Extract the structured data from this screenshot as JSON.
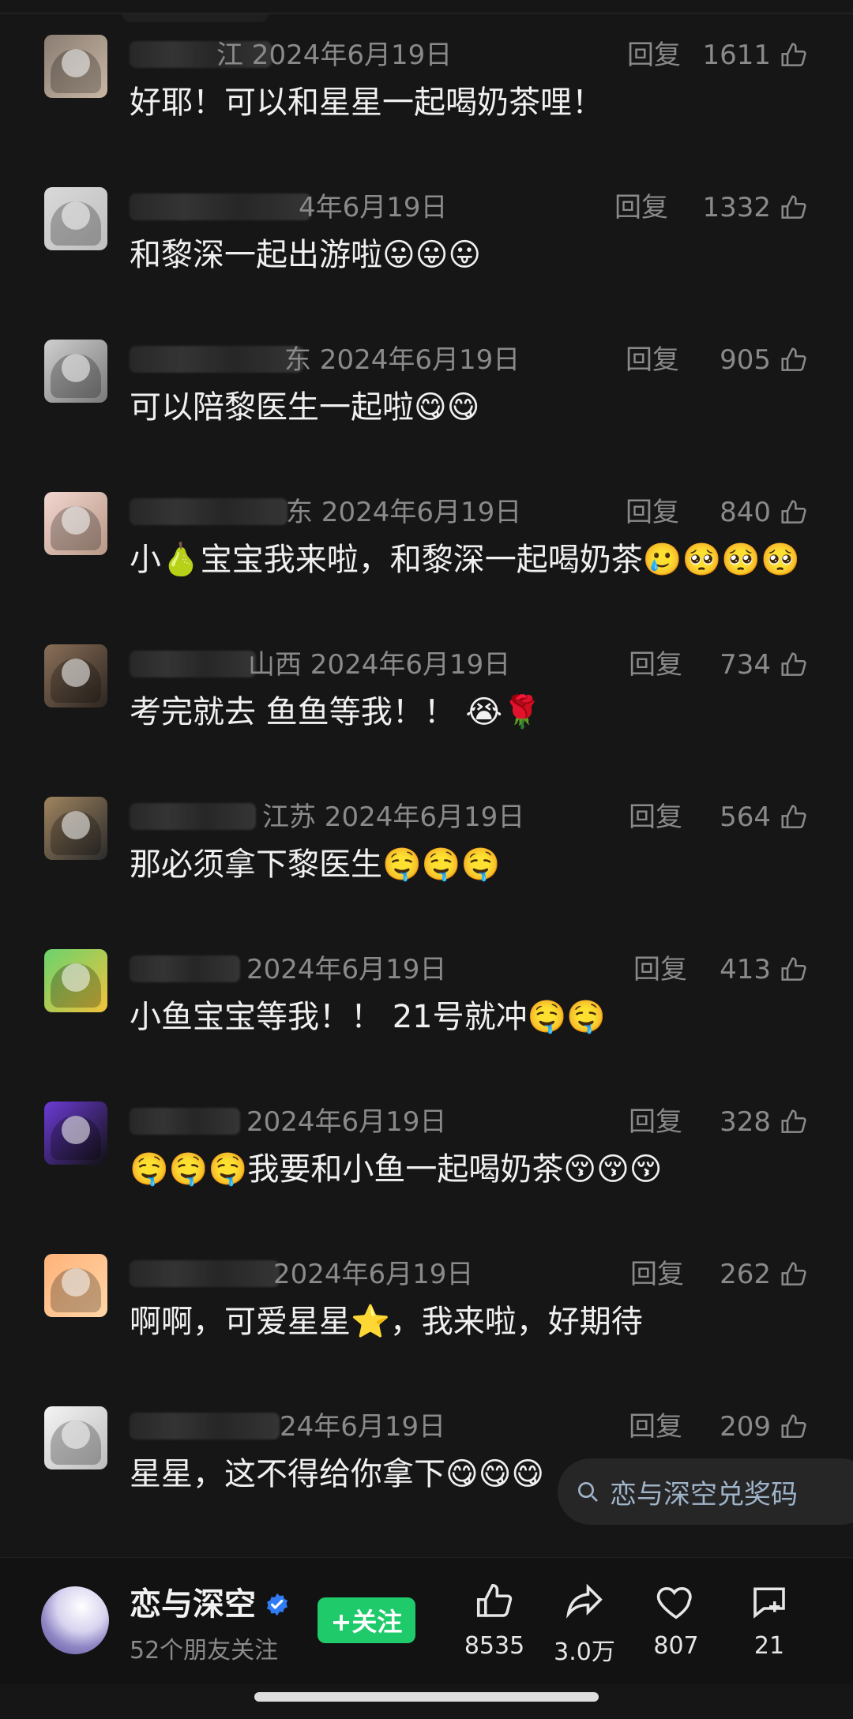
{
  "comments": [
    {
      "meta": "江 2024年6月19日",
      "reply": "回复",
      "likes": "1611",
      "content": "好耶！可以和星星一起喝奶茶哩！"
    },
    {
      "meta": "4年6月19日",
      "reply": "回复",
      "likes": "1332",
      "content": "和黎深一起出游啦😛😛😛"
    },
    {
      "meta": "东 2024年6月19日",
      "reply": "回复",
      "likes": "905",
      "content": "可以陪黎医生一起啦😋😋"
    },
    {
      "meta": "东 2024年6月19日",
      "reply": "回复",
      "likes": "840",
      "content": "小🍐宝宝我来啦，和黎深一起喝奶茶🥲🥺🥺🥺"
    },
    {
      "meta": "山西 2024年6月19日",
      "reply": "回复",
      "likes": "734",
      "content": "考完就去 鱼鱼等我！！ 😭🌹"
    },
    {
      "meta": "江苏 2024年6月19日",
      "reply": "回复",
      "likes": "564",
      "content": "那必须拿下黎医生🤤🤤🤤"
    },
    {
      "meta": "2024年6月19日",
      "reply": "回复",
      "likes": "413",
      "content": "小鱼宝宝等我！！ 21号就冲🤤🤤"
    },
    {
      "meta": "2024年6月19日",
      "reply": "回复",
      "likes": "328",
      "content": "🤤🤤🤤我要和小鱼一起喝奶茶😚😚😚"
    },
    {
      "meta": "2024年6月19日",
      "reply": "回复",
      "likes": "262",
      "content": "啊啊，可爱星星⭐，我来啦，好期待"
    },
    {
      "meta": "24年6月19日",
      "reply": "回复",
      "likes": "209",
      "content": "星星，这不得给你拿下😋😋😋"
    }
  ],
  "search_chip": {
    "label": "恋与深空兑奖码",
    "icon": "search-icon"
  },
  "account": {
    "name": "恋与深空",
    "subtitle": "52个朋友关注",
    "follow_label": "+关注",
    "verified_icon": "verified-badge-icon"
  },
  "actions": {
    "like": "8535",
    "share": "3.0万",
    "favorite": "807",
    "comment": "21"
  },
  "colors": {
    "background": "#161616",
    "follow": "#1fca6b",
    "verified": "#2f7cf6"
  }
}
